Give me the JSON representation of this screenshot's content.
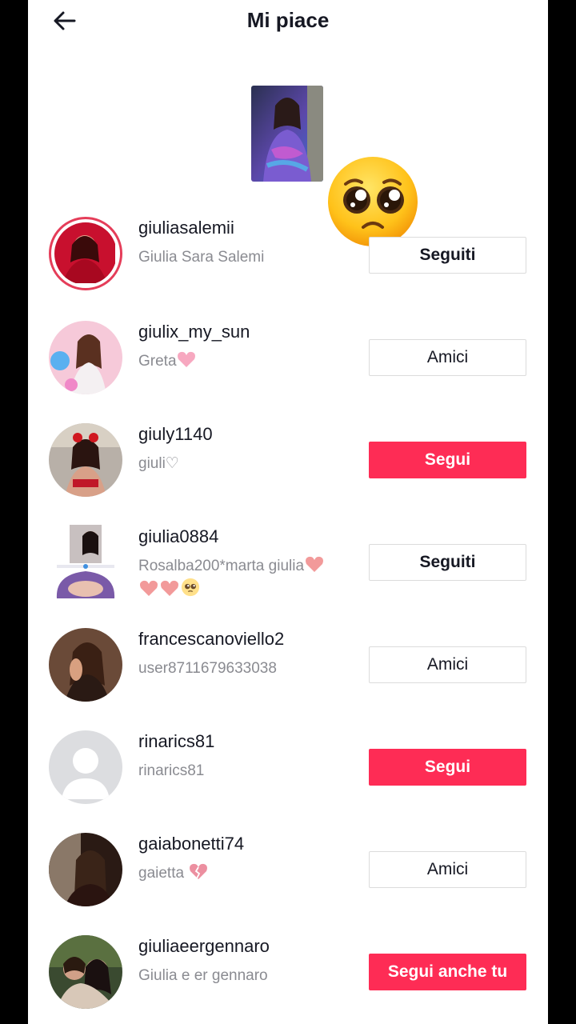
{
  "header": {
    "title": "Mi piace"
  },
  "users": [
    {
      "username": "giuliasalemii",
      "subtitle": "Giulia Sara Salemi",
      "button": "Seguiti",
      "style": "outline"
    },
    {
      "username": "giulix_my_sun",
      "subtitle": "Greta",
      "button": "Amici",
      "style": "outline"
    },
    {
      "username": "giuly1140",
      "subtitle": "giuli♡",
      "button": "Segui",
      "style": "primary"
    },
    {
      "username": "giulia0884",
      "subtitle": "Rosalba200*marta giulia",
      "button": "Seguiti",
      "style": "outline"
    },
    {
      "username": "francescanoviello2",
      "subtitle": "user8711679633038",
      "button": "Amici",
      "style": "outline"
    },
    {
      "username": "rinarics81",
      "subtitle": "rinarics81",
      "button": "Segui",
      "style": "primary"
    },
    {
      "username": "gaiabonetti74",
      "subtitle": "gaietta",
      "button": "Amici",
      "style": "outline"
    },
    {
      "username": "giuliaeergennaro",
      "subtitle": "Giulia e er gennaro",
      "button": "Segui anche tu",
      "style": "primary"
    }
  ],
  "colors": {
    "accent": "#fe2c55",
    "text": "#161823",
    "subtext": "#8a8b91",
    "border": "#dcdcdc"
  }
}
